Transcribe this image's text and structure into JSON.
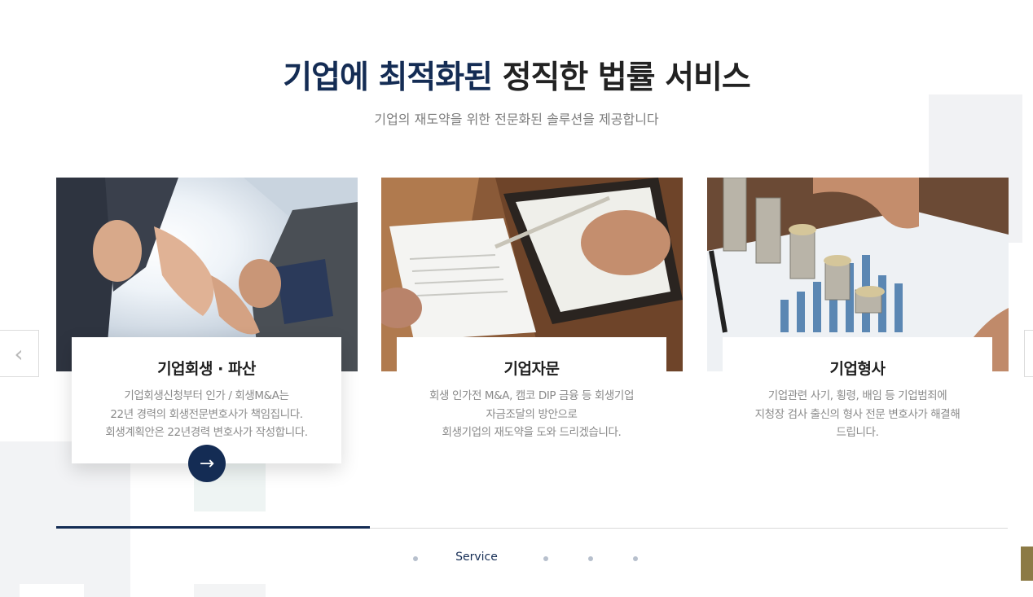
{
  "section": {
    "title_accent": "기업에 최적화된",
    "title_rest": "정직한 법률 서비스",
    "subtitle": "기업의 재도약을 위한 전문화된 솔루션을 제공합니다"
  },
  "cards": [
    {
      "title": "기업회생 · 파산",
      "lines": [
        "기업회생신청부터 인가 / 회생M&A는",
        "22년 경력의 회생전문변호사가 책임집니다.",
        "회생계획안은 22년경력 변호사가 작성합니다."
      ],
      "image": "handshake-photo",
      "active": true
    },
    {
      "title": "기업자문",
      "lines": [
        "회생 인가전 M&A, 캠코 DIP 금융 등 회생기업",
        "자금조달의 방안으로",
        "회생기업의 재도약을 도와 드리겠습니다."
      ],
      "image": "document-signing-photo",
      "active": false
    },
    {
      "title": "기업형사",
      "lines": [
        "기업관련 사기, 횡령, 배임 등 기업범죄에",
        "지청장 검사 출신의 형사 전문 변호사가 해결해",
        "드립니다."
      ],
      "image": "coins-and-chart-photo",
      "active": false
    }
  ],
  "controls": {
    "go_icon": "arrow-right-icon",
    "prev_icon": "chevron-left-icon",
    "next_icon": "chevron-right-icon",
    "go_glyph": "→",
    "prev_glyph": "‹",
    "next_glyph": "›"
  },
  "pagination": {
    "current_label": "Service",
    "progress_fraction": 0.33,
    "total_slides": 5,
    "current_index": 1
  },
  "colors": {
    "accent": "#142c54",
    "gold_tab": "#8c7a45",
    "text_muted": "#8a8a8a"
  }
}
